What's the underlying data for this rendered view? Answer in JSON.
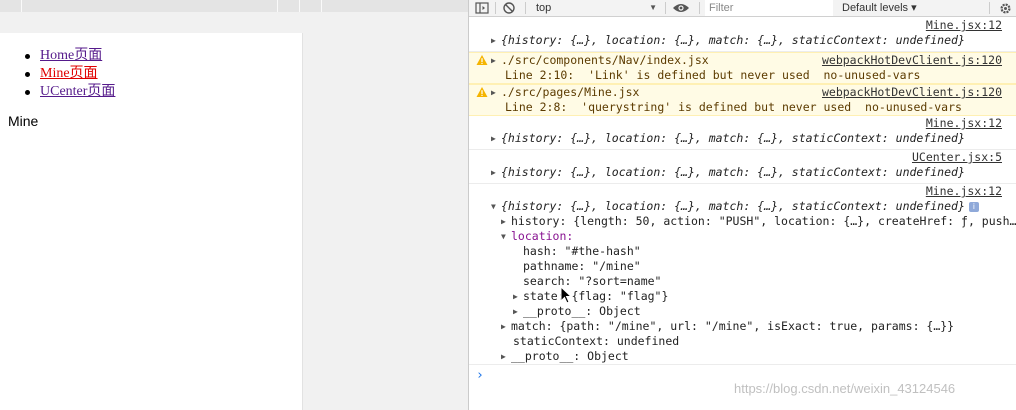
{
  "page": {
    "nav_links": [
      "Home页面",
      "Mine页面",
      "UCenter页面"
    ],
    "content_text": "Mine"
  },
  "devtools": {
    "context": "top",
    "filter_placeholder": "Filter",
    "levels": "Default levels ▾"
  },
  "console": {
    "entries": [
      {
        "source": "Mine.jsx:12",
        "body": "{history: {…}, location: {…}, match: {…}, staticContext: undefined}"
      },
      {
        "type": "warning",
        "source": "webpackHotDevClient.js:120",
        "file": "./src/components/Nav/index.jsx",
        "detail": "Line 2:10:  'Link' is defined but never used  no-unused-vars"
      },
      {
        "type": "warning",
        "source": "webpackHotDevClient.js:120",
        "file": "./src/pages/Mine.jsx",
        "detail": "Line 2:8:  'querystring' is defined but never used  no-unused-vars"
      },
      {
        "source": "Mine.jsx:12",
        "body": "{history: {…}, location: {…}, match: {…}, staticContext: undefined}"
      },
      {
        "source": "UCenter.jsx:5",
        "body": "{history: {…}, location: {…}, match: {…}, staticContext: undefined}"
      },
      {
        "source": "Mine.jsx:12",
        "body": "{history: {…}, location: {…}, match: {…}, staticContext: undefined}",
        "expanded": true
      }
    ],
    "expanded_tree": {
      "history": "history: {length: 50, action: \"PUSH\", location: {…}, createHref: ƒ, push…",
      "location_label": "location:",
      "hash": "hash: \"#the-hash\"",
      "pathname": "pathname: \"/mine\"",
      "search": "search: \"?sort=name\"",
      "state": "state: {flag: \"flag\"}",
      "loc_proto": "__proto__: Object",
      "match": "match: {path: \"/mine\", url: \"/mine\", isExact: true, params: {…}}",
      "static_context": "staticContext: undefined",
      "proto": "__proto__: Object"
    },
    "prompt": "›"
  },
  "watermark": "https://blog.csdn.net/weixin_43124546"
}
